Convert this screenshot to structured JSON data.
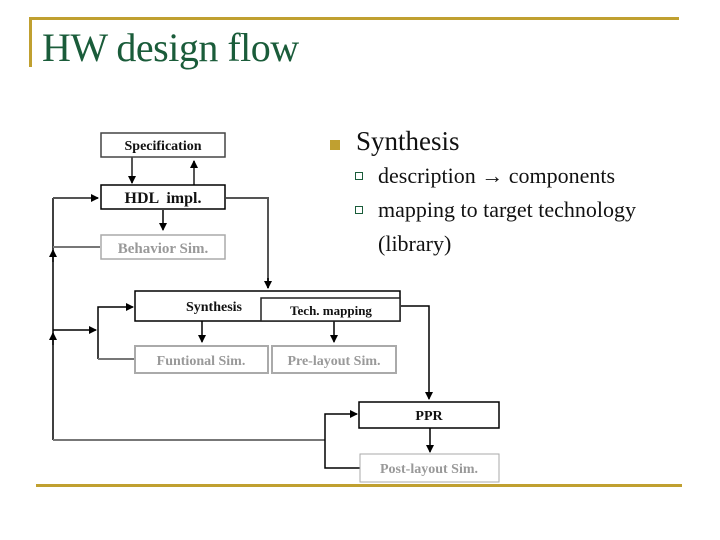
{
  "slide": {
    "title": "HW design flow",
    "accent_color": "#c0a030",
    "title_color": "#1a5c3a"
  },
  "bullets": {
    "main": "Synthesis",
    "sub": [
      "description → components",
      "mapping to target technology (library)"
    ],
    "sub2_line1": "mapping to target technology",
    "sub2_line2": "(library)"
  },
  "diagram": {
    "nodes": {
      "specification": "Specification",
      "hdl_impl": "HDL  impl.",
      "behavior_sim": "Behavior Sim.",
      "synthesis": "Synthesis",
      "tech_mapping": "Tech. mapping",
      "functional_sim": "Funtional Sim.",
      "prelayout_sim": "Pre-layout Sim.",
      "ppr": "PPR",
      "postlayout_sim": "Post-layout Sim."
    }
  }
}
